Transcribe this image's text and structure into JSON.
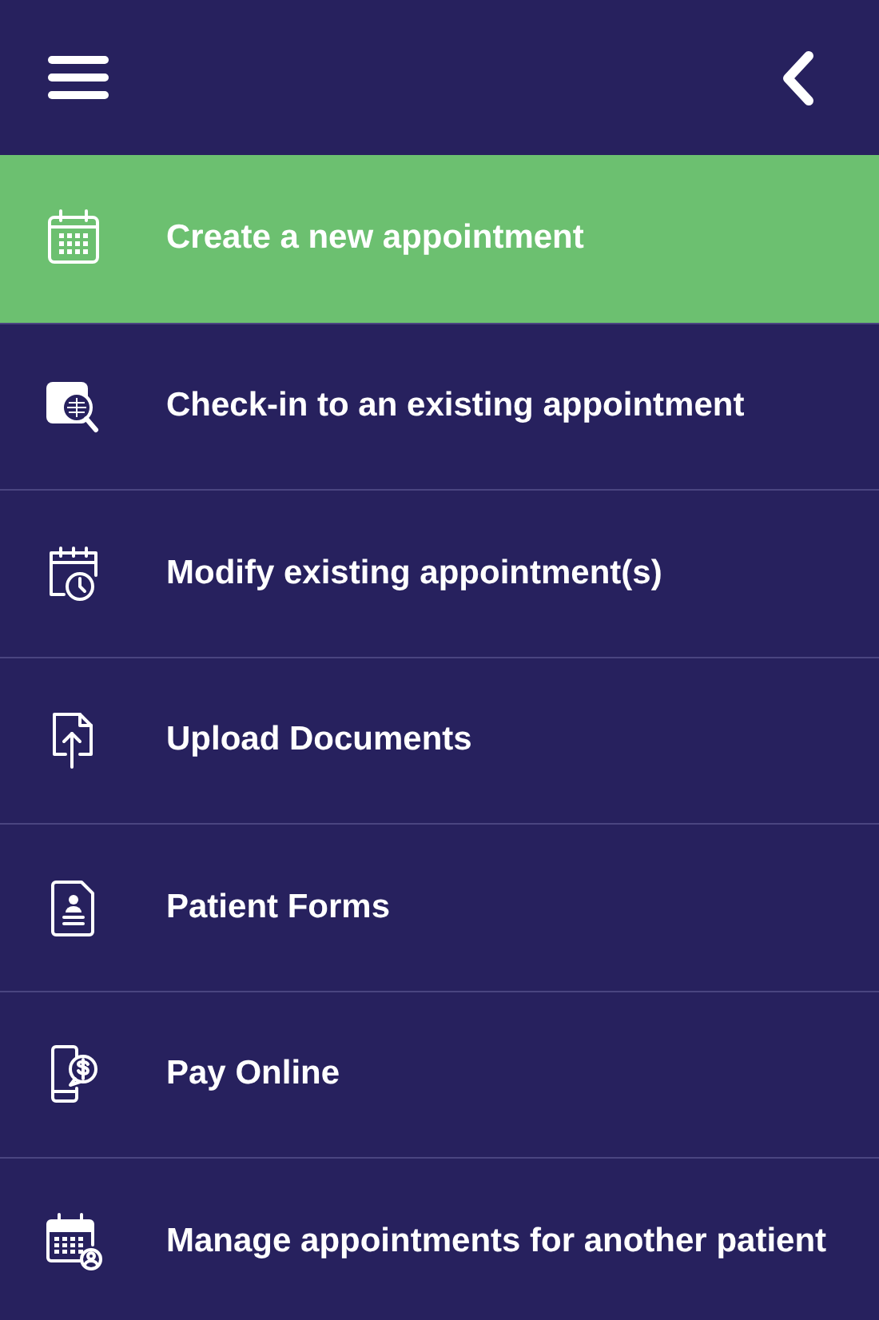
{
  "menu_items": [
    {
      "kind": "calendar",
      "label": "Create a new appointment",
      "selected": true
    },
    {
      "kind": "search",
      "label": "Check-in to an existing appointment",
      "selected": false
    },
    {
      "kind": "calendar-clock",
      "label": "Modify existing appointment(s)",
      "selected": false
    },
    {
      "kind": "upload",
      "label": "Upload Documents",
      "selected": false
    },
    {
      "kind": "form",
      "label": "Patient Forms",
      "selected": false
    },
    {
      "kind": "pay",
      "label": "Pay Online",
      "selected": false
    },
    {
      "kind": "calendar-person",
      "label": "Manage appointments for another patient",
      "selected": false
    }
  ]
}
